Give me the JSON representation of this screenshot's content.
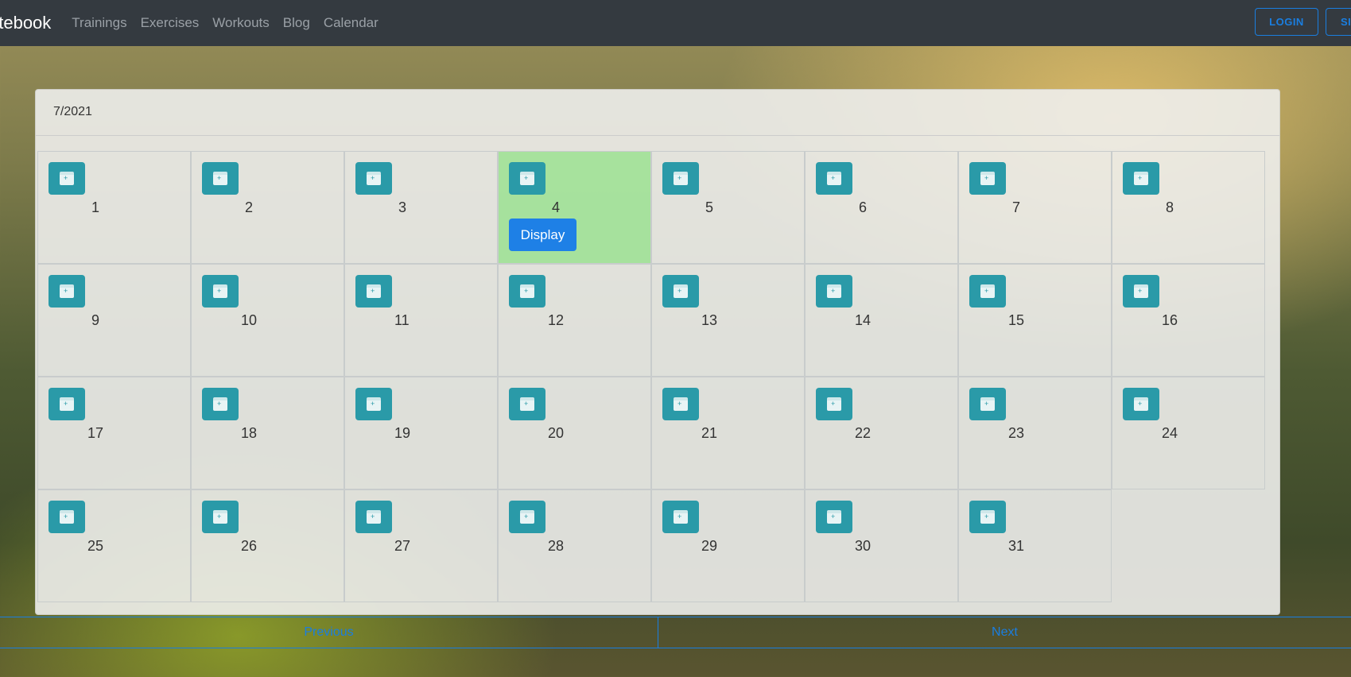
{
  "nav": {
    "brand": "otebook",
    "links": [
      "Trainings",
      "Exercises",
      "Workouts",
      "Blog",
      "Calendar"
    ],
    "login": "LOGIN",
    "signup": "SI"
  },
  "calendar": {
    "month_label": "7/2021",
    "days": [
      "1",
      "2",
      "3",
      "4",
      "5",
      "6",
      "7",
      "8",
      "9",
      "10",
      "11",
      "12",
      "13",
      "14",
      "15",
      "16",
      "17",
      "18",
      "19",
      "20",
      "21",
      "22",
      "23",
      "24",
      "25",
      "26",
      "27",
      "28",
      "29",
      "30",
      "31"
    ],
    "today": "4",
    "display_label": "Display"
  },
  "pagination": {
    "previous": "Previous",
    "next": "Next"
  }
}
